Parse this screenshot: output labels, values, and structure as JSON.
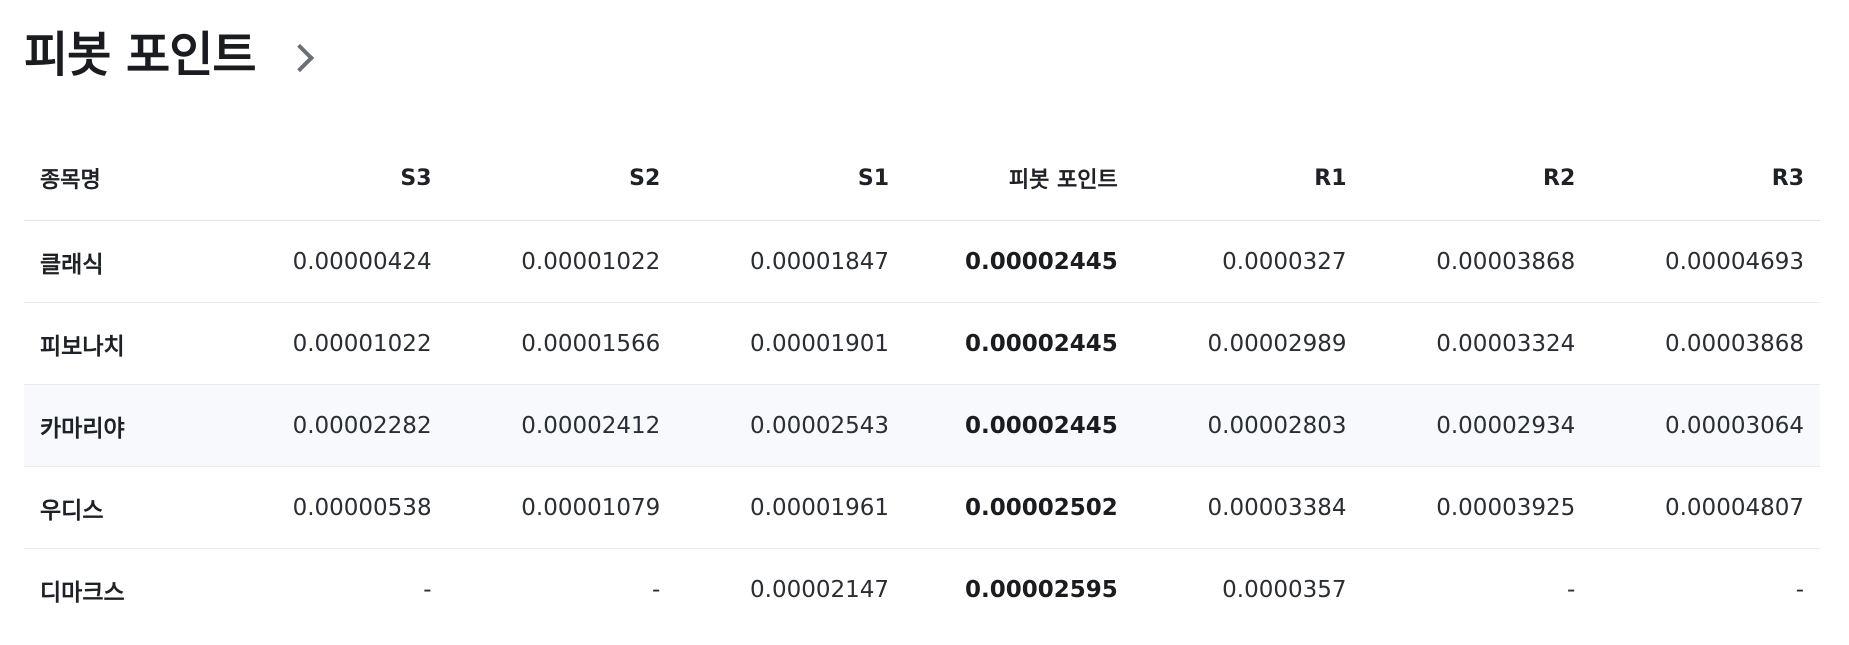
{
  "section": {
    "title": "피봇 포인트",
    "chevron_icon": "chevron-right-icon"
  },
  "table": {
    "headers": [
      "종목명",
      "S3",
      "S2",
      "S1",
      "피봇 포인트",
      "R1",
      "R2",
      "R3"
    ],
    "rows": [
      {
        "name": "클래식",
        "s3": "0.00000424",
        "s2": "0.00001022",
        "s1": "0.00001847",
        "pivot": "0.00002445",
        "r1": "0.0000327",
        "r2": "0.00003868",
        "r3": "0.00004693"
      },
      {
        "name": "피보나치",
        "s3": "0.00001022",
        "s2": "0.00001566",
        "s1": "0.00001901",
        "pivot": "0.00002445",
        "r1": "0.00002989",
        "r2": "0.00003324",
        "r3": "0.00003868"
      },
      {
        "name": "카마리야",
        "s3": "0.00002282",
        "s2": "0.00002412",
        "s1": "0.00002543",
        "pivot": "0.00002445",
        "r1": "0.00002803",
        "r2": "0.00002934",
        "r3": "0.00003064"
      },
      {
        "name": "우디스",
        "s3": "0.00000538",
        "s2": "0.00001079",
        "s1": "0.00001961",
        "pivot": "0.00002502",
        "r1": "0.00003384",
        "r2": "0.00003925",
        "r3": "0.00004807"
      },
      {
        "name": "디마크스",
        "s3": "-",
        "s2": "-",
        "s1": "0.00002147",
        "pivot": "0.00002595",
        "r1": "0.0000357",
        "r2": "-",
        "r3": "-"
      }
    ],
    "highlighted_row_color": "#f7f9fc"
  }
}
